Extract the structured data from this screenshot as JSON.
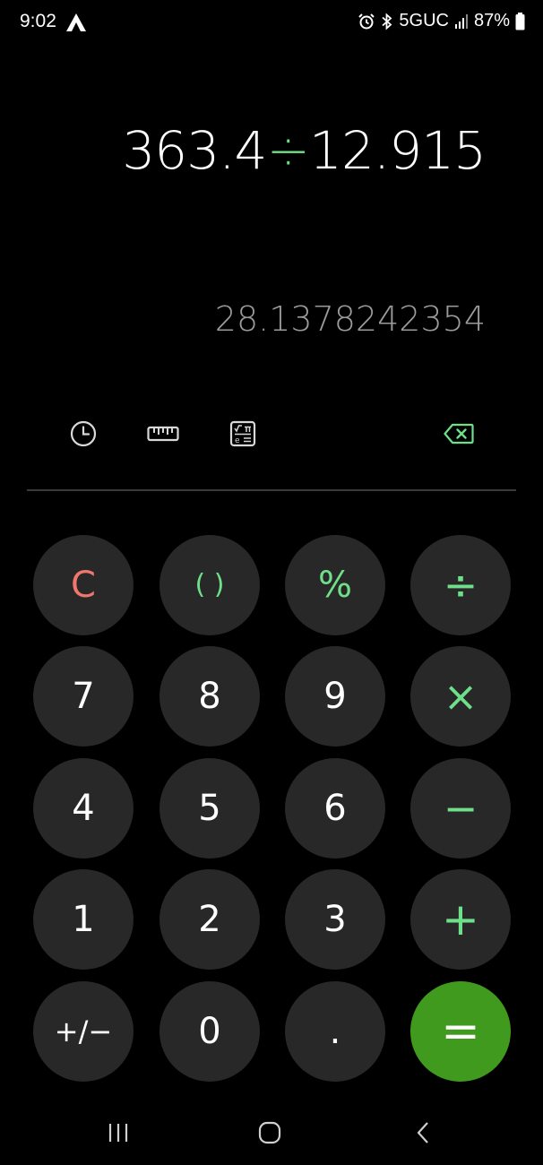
{
  "status_bar": {
    "time": "9:02",
    "app_icon": "arrow-a-icon",
    "network": "5GUC",
    "battery": "87%",
    "icons": [
      "alarm-icon",
      "bluetooth-icon",
      "signal-icon",
      "battery-icon"
    ]
  },
  "display": {
    "expression_left": "363.4",
    "expression_operator": "÷",
    "expression_right": "12.915",
    "result": "28.1378242354"
  },
  "toolbar": {
    "icons": [
      "history-icon",
      "unit-converter-icon",
      "scientific-mode-icon",
      "backspace-icon"
    ]
  },
  "keypad": {
    "rows": [
      [
        "C",
        "( )",
        "%",
        "÷"
      ],
      [
        "7",
        "8",
        "9",
        "×"
      ],
      [
        "4",
        "5",
        "6",
        "−"
      ],
      [
        "1",
        "2",
        "3",
        "+"
      ],
      [
        "+/−",
        "0",
        ".",
        "="
      ]
    ]
  },
  "navigation": {
    "icons": [
      "recent-apps-icon",
      "home-icon",
      "back-icon"
    ]
  },
  "colors": {
    "accent_green": "#6fe08a",
    "clear_red": "#f0766e",
    "equals_bg": "#3f9a1d",
    "key_bg": "#282828",
    "background": "#000000",
    "result_gray": "#9b9b9b"
  }
}
